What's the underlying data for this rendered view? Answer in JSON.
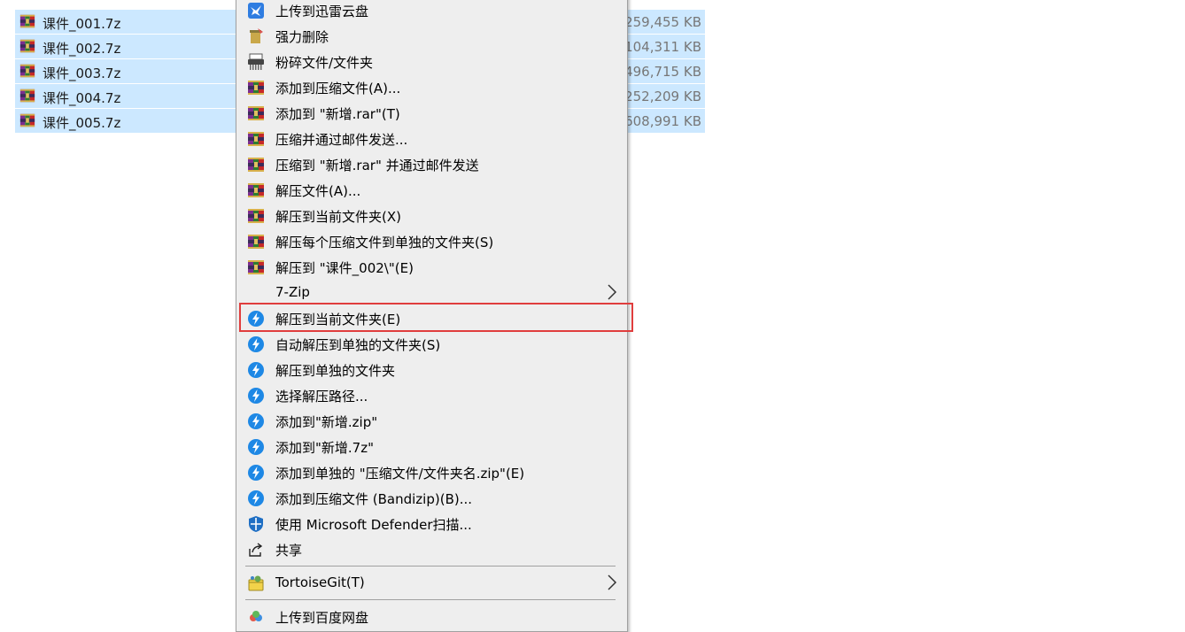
{
  "files": [
    {
      "name": "课件_001.7z",
      "size": "259,455 KB"
    },
    {
      "name": "课件_002.7z",
      "size": "104,311 KB"
    },
    {
      "name": "课件_003.7z",
      "size": "496,715 KB"
    },
    {
      "name": "课件_004.7z",
      "size": "252,209 KB"
    },
    {
      "name": "课件_005.7z",
      "size": "608,991 KB"
    }
  ],
  "menu": {
    "xunlei": "上传到迅雷云盘",
    "force_delete": "强力删除",
    "shred": "粉碎文件/文件夹",
    "winrar_add": "添加到压缩文件(A)...",
    "winrar_add_named": "添加到 \"新增.rar\"(T)",
    "winrar_email": "压缩并通过邮件发送...",
    "winrar_email_named": "压缩到 \"新增.rar\" 并通过邮件发送",
    "winrar_extract": "解压文件(A)...",
    "winrar_extract_here": "解压到当前文件夹(X)",
    "winrar_extract_each": "解压每个压缩文件到单独的文件夹(S)",
    "winrar_extract_to": "解压到 \"课件_002\\\"(E)",
    "sevenzip": "7-Zip",
    "bz_extract_here": "解压到当前文件夹(E)",
    "bz_auto_extract": "自动解压到单独的文件夹(S)",
    "bz_extract_separate": "解压到单独的文件夹",
    "bz_choose_path": "选择解压路径...",
    "bz_add_zip": "添加到\"新增.zip\"",
    "bz_add_7z": "添加到\"新增.7z\"",
    "bz_add_each": "添加到单独的 \"压缩文件/文件夹名.zip\"(E)",
    "bz_add_archive": "添加到压缩文件 (Bandizip)(B)...",
    "defender": "使用 Microsoft Defender扫描...",
    "share": "共享",
    "tortoisegit": "TortoiseGit(T)",
    "baidu": "上传到百度网盘"
  },
  "colors": {
    "selection": "#cce8ff",
    "menu_bg": "#eeeeee",
    "highlight_border": "#e03d3d",
    "bandizip_blue": "#1e88e5"
  },
  "icons": {
    "file": "winrar-archive-icon",
    "xunlei": "xunlei-bird-icon",
    "delete": "force-delete-icon",
    "shred": "shredder-icon",
    "winrar": "winrar-books-icon",
    "bandizip": "bandizip-bolt-icon",
    "defender": "shield-icon",
    "share": "share-icon",
    "tortoisegit": "tortoisegit-icon",
    "baidu": "baidu-cloud-icon",
    "submenu": "chevron-right-icon"
  }
}
